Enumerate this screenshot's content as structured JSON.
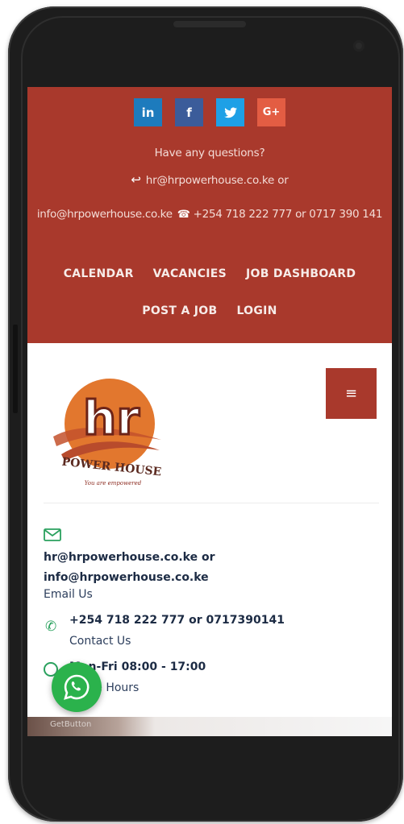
{
  "social": {
    "linkedin": "in",
    "facebook": "f",
    "twitter": "t",
    "googleplus": "G+"
  },
  "topbar": {
    "questions": "Have any questions?",
    "email_primary": "hr@hrpowerhouse.co.ke or",
    "email_secondary": "info@hrpowerhouse.co.ke",
    "phone_text": "+254 718 222 777 or 0717 390 141"
  },
  "nav": {
    "items": [
      "CALENDAR",
      "VACANCIES",
      "JOB DASHBOARD",
      "POST A JOB",
      "LOGIN"
    ]
  },
  "logo": {
    "initials": "hr",
    "brand": "POWER HOUSE",
    "tagline": "You are empowered"
  },
  "menu": {
    "icon": "hamburger-icon"
  },
  "contact": {
    "emails": "hr@hrpowerhouse.co.ke or",
    "emails2": "info@hrpowerhouse.co.ke",
    "email_label": "Email Us",
    "phones": "+254 718 222 777 or 0717390141",
    "phone_label": "Contact Us",
    "hours": "Mon-Fri 08:00 - 17:00",
    "hours_label": "Office Hours"
  },
  "widget": {
    "label": "GetButton"
  },
  "colors": {
    "brand": "#a9392c",
    "accent_green": "#2aa15e",
    "whatsapp": "#2bb24c"
  }
}
